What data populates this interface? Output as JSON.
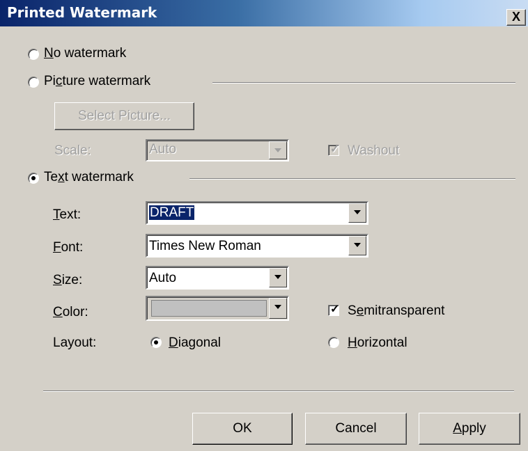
{
  "dialog": {
    "title": "Printed Watermark",
    "close_glyph": "X"
  },
  "options": {
    "no_watermark": {
      "label_prefix": "",
      "mnemonic": "N",
      "label_rest": "o watermark",
      "selected": false
    },
    "picture_watermark": {
      "label_prefix": "Pi",
      "mnemonic": "c",
      "label_rest": "ture watermark",
      "selected": false
    },
    "text_watermark": {
      "label_prefix": "Te",
      "mnemonic": "x",
      "label_rest": "t watermark",
      "selected": true
    }
  },
  "picture": {
    "select_button": "Select Picture...",
    "scale_label": "Scale:",
    "scale_value": "Auto",
    "washout_label": "Washout",
    "washout_checked": true
  },
  "text_settings": {
    "text_label_mnemonic": "T",
    "text_label_rest": "ext:",
    "text_value": "DRAFT",
    "font_label_mnemonic": "F",
    "font_label_rest": "ont:",
    "font_value": "Times New Roman",
    "size_label_mnemonic": "S",
    "size_label_rest": "ize:",
    "size_value": "Auto",
    "color_label_mnemonic": "C",
    "color_label_rest": "olor:",
    "color_value_hex": "#c0c0c0",
    "semitransparent_prefix": "S",
    "semitransparent_mnemonic": "e",
    "semitransparent_rest": "mitransparent",
    "semitransparent_checked": true,
    "layout_label": "Layout:",
    "diagonal_mnemonic": "D",
    "diagonal_rest": "iagonal",
    "diagonal_selected": true,
    "horizontal_mnemonic": "H",
    "horizontal_rest": "orizontal",
    "horizontal_selected": false
  },
  "buttons": {
    "ok": "OK",
    "cancel": "Cancel",
    "apply_mnemonic": "A",
    "apply_rest": "pply"
  }
}
